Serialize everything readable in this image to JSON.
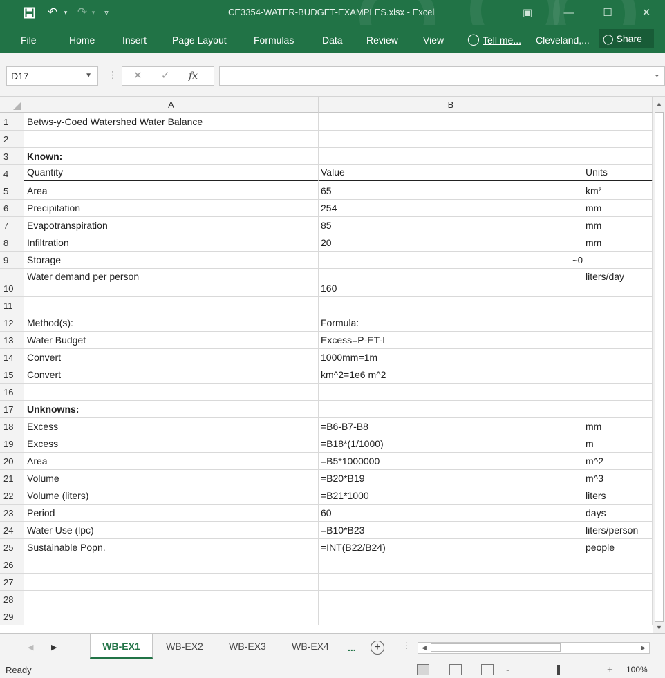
{
  "window": {
    "title": "CE3354-WATER-BUDGET-EXAMPLES.xlsx - Excel"
  },
  "ribbon": {
    "tabs": [
      "File",
      "Home",
      "Insert",
      "Page Layout",
      "Formulas",
      "Data",
      "Review",
      "View"
    ],
    "tell_me": "Tell me...",
    "account": "Cleveland,...",
    "share": "Share"
  },
  "formula_bar": {
    "name_box": "D17",
    "fx_label": "fx",
    "formula": ""
  },
  "grid": {
    "column_headers": [
      "A",
      "B"
    ],
    "rows": [
      {
        "num": "1",
        "a": "Betws-y-Coed Watershed Water Balance",
        "b": "",
        "c": ""
      },
      {
        "num": "2",
        "a": "",
        "b": "",
        "c": ""
      },
      {
        "num": "3",
        "a": "Known:",
        "b": "",
        "c": ""
      },
      {
        "num": "4",
        "a": "Quantity",
        "b": "Value",
        "c": "Units"
      },
      {
        "num": "5",
        "a": "Area",
        "b": "65",
        "c": "km²"
      },
      {
        "num": "6",
        "a": "Precipitation",
        "b": "254",
        "c": "mm"
      },
      {
        "num": "7",
        "a": "Evapotranspiration",
        "b": "85",
        "c": "mm"
      },
      {
        "num": "8",
        "a": "Infiltration",
        "b": "20",
        "c": "mm"
      },
      {
        "num": "9",
        "a": "Storage",
        "b": "~0",
        "c": ""
      },
      {
        "num": "10",
        "a": "Water demand per person",
        "b": "160",
        "c": "liters/day"
      },
      {
        "num": "11",
        "a": "",
        "b": "",
        "c": ""
      },
      {
        "num": "12",
        "a": "Method(s):",
        "b": "Formula:",
        "c": ""
      },
      {
        "num": "13",
        "a": "Water Budget",
        "b": "Excess=P-ET-I",
        "c": ""
      },
      {
        "num": "14",
        "a": "Convert",
        "b": "1000mm=1m",
        "c": ""
      },
      {
        "num": "15",
        "a": "Convert",
        "b": "km^2=1e6 m^2",
        "c": ""
      },
      {
        "num": "16",
        "a": "",
        "b": "",
        "c": ""
      },
      {
        "num": "17",
        "a": "Unknowns:",
        "b": "",
        "c": ""
      },
      {
        "num": "18",
        "a": "Excess",
        "b": "=B6-B7-B8",
        "c": "mm"
      },
      {
        "num": "19",
        "a": "Excess",
        "b": "=B18*(1/1000)",
        "c": "m"
      },
      {
        "num": "20",
        "a": "Area",
        "b": "=B5*1000000",
        "c": "m^2"
      },
      {
        "num": "21",
        "a": "Volume",
        "b": "=B20*B19",
        "c": "m^3"
      },
      {
        "num": "22",
        "a": "Volume (liters)",
        "b": "=B21*1000",
        "c": "liters"
      },
      {
        "num": "23",
        "a": "Period",
        "b": "60",
        "c": "days"
      },
      {
        "num": "24",
        "a": "Water Use (lpc)",
        "b": "=B10*B23",
        "c": "liters/person"
      },
      {
        "num": "25",
        "a": "Sustainable Popn.",
        "b": "=INT(B22/B24)",
        "c": "people"
      },
      {
        "num": "26",
        "a": "",
        "b": "",
        "c": ""
      },
      {
        "num": "27",
        "a": "",
        "b": "",
        "c": ""
      },
      {
        "num": "28",
        "a": "",
        "b": "",
        "c": ""
      },
      {
        "num": "29",
        "a": "",
        "b": "",
        "c": ""
      }
    ]
  },
  "sheets": {
    "tabs": [
      "WB-EX1",
      "WB-EX2",
      "WB-EX3",
      "WB-EX4"
    ],
    "more": "...",
    "add": "+"
  },
  "status": {
    "text": "Ready",
    "zoom": "100%",
    "zoom_minus": "-",
    "zoom_plus": "+"
  }
}
